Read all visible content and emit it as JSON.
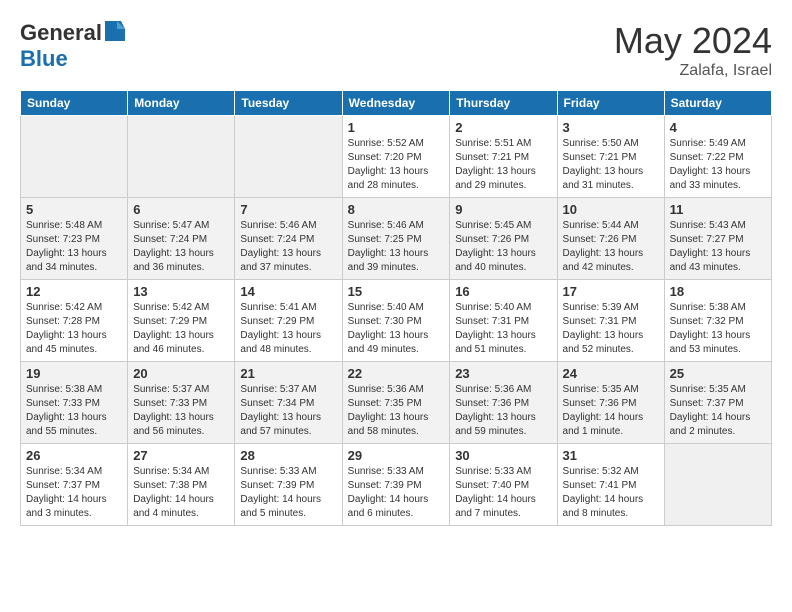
{
  "header": {
    "logo_general": "General",
    "logo_blue": "Blue",
    "month": "May 2024",
    "location": "Zalafa, Israel"
  },
  "days_of_week": [
    "Sunday",
    "Monday",
    "Tuesday",
    "Wednesday",
    "Thursday",
    "Friday",
    "Saturday"
  ],
  "weeks": [
    [
      {
        "day": "",
        "info": ""
      },
      {
        "day": "",
        "info": ""
      },
      {
        "day": "",
        "info": ""
      },
      {
        "day": "1",
        "info": "Sunrise: 5:52 AM\nSunset: 7:20 PM\nDaylight: 13 hours\nand 28 minutes."
      },
      {
        "day": "2",
        "info": "Sunrise: 5:51 AM\nSunset: 7:21 PM\nDaylight: 13 hours\nand 29 minutes."
      },
      {
        "day": "3",
        "info": "Sunrise: 5:50 AM\nSunset: 7:21 PM\nDaylight: 13 hours\nand 31 minutes."
      },
      {
        "day": "4",
        "info": "Sunrise: 5:49 AM\nSunset: 7:22 PM\nDaylight: 13 hours\nand 33 minutes."
      }
    ],
    [
      {
        "day": "5",
        "info": "Sunrise: 5:48 AM\nSunset: 7:23 PM\nDaylight: 13 hours\nand 34 minutes."
      },
      {
        "day": "6",
        "info": "Sunrise: 5:47 AM\nSunset: 7:24 PM\nDaylight: 13 hours\nand 36 minutes."
      },
      {
        "day": "7",
        "info": "Sunrise: 5:46 AM\nSunset: 7:24 PM\nDaylight: 13 hours\nand 37 minutes."
      },
      {
        "day": "8",
        "info": "Sunrise: 5:46 AM\nSunset: 7:25 PM\nDaylight: 13 hours\nand 39 minutes."
      },
      {
        "day": "9",
        "info": "Sunrise: 5:45 AM\nSunset: 7:26 PM\nDaylight: 13 hours\nand 40 minutes."
      },
      {
        "day": "10",
        "info": "Sunrise: 5:44 AM\nSunset: 7:26 PM\nDaylight: 13 hours\nand 42 minutes."
      },
      {
        "day": "11",
        "info": "Sunrise: 5:43 AM\nSunset: 7:27 PM\nDaylight: 13 hours\nand 43 minutes."
      }
    ],
    [
      {
        "day": "12",
        "info": "Sunrise: 5:42 AM\nSunset: 7:28 PM\nDaylight: 13 hours\nand 45 minutes."
      },
      {
        "day": "13",
        "info": "Sunrise: 5:42 AM\nSunset: 7:29 PM\nDaylight: 13 hours\nand 46 minutes."
      },
      {
        "day": "14",
        "info": "Sunrise: 5:41 AM\nSunset: 7:29 PM\nDaylight: 13 hours\nand 48 minutes."
      },
      {
        "day": "15",
        "info": "Sunrise: 5:40 AM\nSunset: 7:30 PM\nDaylight: 13 hours\nand 49 minutes."
      },
      {
        "day": "16",
        "info": "Sunrise: 5:40 AM\nSunset: 7:31 PM\nDaylight: 13 hours\nand 51 minutes."
      },
      {
        "day": "17",
        "info": "Sunrise: 5:39 AM\nSunset: 7:31 PM\nDaylight: 13 hours\nand 52 minutes."
      },
      {
        "day": "18",
        "info": "Sunrise: 5:38 AM\nSunset: 7:32 PM\nDaylight: 13 hours\nand 53 minutes."
      }
    ],
    [
      {
        "day": "19",
        "info": "Sunrise: 5:38 AM\nSunset: 7:33 PM\nDaylight: 13 hours\nand 55 minutes."
      },
      {
        "day": "20",
        "info": "Sunrise: 5:37 AM\nSunset: 7:33 PM\nDaylight: 13 hours\nand 56 minutes."
      },
      {
        "day": "21",
        "info": "Sunrise: 5:37 AM\nSunset: 7:34 PM\nDaylight: 13 hours\nand 57 minutes."
      },
      {
        "day": "22",
        "info": "Sunrise: 5:36 AM\nSunset: 7:35 PM\nDaylight: 13 hours\nand 58 minutes."
      },
      {
        "day": "23",
        "info": "Sunrise: 5:36 AM\nSunset: 7:36 PM\nDaylight: 13 hours\nand 59 minutes."
      },
      {
        "day": "24",
        "info": "Sunrise: 5:35 AM\nSunset: 7:36 PM\nDaylight: 14 hours\nand 1 minute."
      },
      {
        "day": "25",
        "info": "Sunrise: 5:35 AM\nSunset: 7:37 PM\nDaylight: 14 hours\nand 2 minutes."
      }
    ],
    [
      {
        "day": "26",
        "info": "Sunrise: 5:34 AM\nSunset: 7:37 PM\nDaylight: 14 hours\nand 3 minutes."
      },
      {
        "day": "27",
        "info": "Sunrise: 5:34 AM\nSunset: 7:38 PM\nDaylight: 14 hours\nand 4 minutes."
      },
      {
        "day": "28",
        "info": "Sunrise: 5:33 AM\nSunset: 7:39 PM\nDaylight: 14 hours\nand 5 minutes."
      },
      {
        "day": "29",
        "info": "Sunrise: 5:33 AM\nSunset: 7:39 PM\nDaylight: 14 hours\nand 6 minutes."
      },
      {
        "day": "30",
        "info": "Sunrise: 5:33 AM\nSunset: 7:40 PM\nDaylight: 14 hours\nand 7 minutes."
      },
      {
        "day": "31",
        "info": "Sunrise: 5:32 AM\nSunset: 7:41 PM\nDaylight: 14 hours\nand 8 minutes."
      },
      {
        "day": "",
        "info": ""
      }
    ]
  ]
}
